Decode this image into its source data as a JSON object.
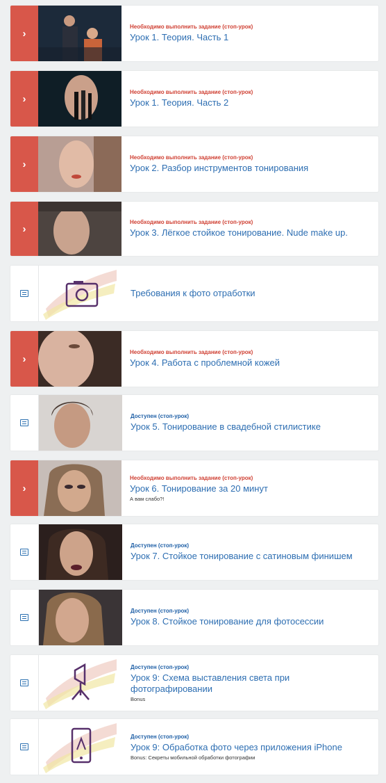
{
  "lessons": [
    {
      "status": "Необходимо выполнить задание (стоп-урок)",
      "title": "Урок 1. Теория. Часть 1",
      "subtitle": "",
      "locked": true
    },
    {
      "status": "Необходимо выполнить задание (стоп-урок)",
      "title": "Урок 1. Теория. Часть 2",
      "subtitle": "",
      "locked": true
    },
    {
      "status": "Необходимо выполнить задание (стоп-урок)",
      "title": "Урок 2. Разбор инструментов тонирования",
      "subtitle": "",
      "locked": true
    },
    {
      "status": "Необходимо выполнить задание (стоп-урок)",
      "title": "Урок 3. Лёгкое стойкое тонирование. Nude make up.",
      "subtitle": "",
      "locked": true
    },
    {
      "status": "",
      "title": "Требования к фото отработки",
      "subtitle": "",
      "locked": false
    },
    {
      "status": "Необходимо выполнить задание (стоп-урок)",
      "title": "Урок 4. Работа с проблемной кожей",
      "subtitle": "",
      "locked": true
    },
    {
      "status": "Доступен (стоп-урок)",
      "title": "Урок 5. Тонирование в свадебной стилистике",
      "subtitle": "",
      "locked": false
    },
    {
      "status": "Необходимо выполнить задание (стоп-урок)",
      "title": "Урок 6. Тонирование за 20 минут",
      "subtitle": "А вам слабо?!",
      "locked": true
    },
    {
      "status": "Доступен (стоп-урок)",
      "title": "Урок 7. Стойкое тонирование с сатиновым финишем",
      "subtitle": "",
      "locked": false
    },
    {
      "status": "Доступен (стоп-урок)",
      "title": "Урок 8. Стойкое тонирование для фотосессии",
      "subtitle": "",
      "locked": false
    },
    {
      "status": "Доступен (стоп-урок)",
      "title": "Урок 9: Схема выставления света при фотографировании",
      "subtitle": "Bonus",
      "locked": false
    },
    {
      "status": "Доступен (стоп-урок)",
      "title": "Урок 9: Обработка фото через приложения iPhone",
      "subtitle": "Bonus: Секреты мобильной обработки фотографии",
      "locked": false
    }
  ],
  "colors": {
    "locked": "#d8574a",
    "title": "#2d6eb2",
    "status_locked": "#cf3f32",
    "status_open": "#1e5fa6"
  }
}
